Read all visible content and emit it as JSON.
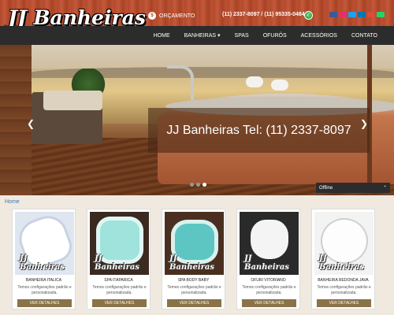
{
  "header": {
    "logo_text": "JJ Banheiras",
    "quote_label": "ORÇAMENTO",
    "phones": "(11) 2337-8097 / (11) 95335-0484",
    "social_colors": [
      "#3b5998",
      "#e1306c",
      "#1da1f2",
      "#0077b5",
      "#dd4b39",
      "#25d366"
    ]
  },
  "nav": {
    "items": [
      "HOME",
      "BANHEIRAS ▾",
      "SPAS",
      "OFURÔS",
      "ACESSÓRIOS",
      "CONTATO"
    ]
  },
  "hero": {
    "caption": "JJ Banheiras Tel: (11) 2337-8097",
    "slide_count": 3,
    "active_slide": 3
  },
  "chat": {
    "status": "Offline",
    "toggle": "⌃"
  },
  "breadcrumb": {
    "home": "Home"
  },
  "products": [
    {
      "title": "BANHEIRA ITALICA",
      "desc": "Temos configurações padrão e personalizada.",
      "button": "VER DETALHES",
      "img_color": "#e8eef6"
    },
    {
      "title": "SPA ITAPARICA",
      "desc": "Temos configurações padrão e personalizada.",
      "button": "VER DETALHES",
      "img_color": "#7fd6d0"
    },
    {
      "title": "SPA BODY BABY",
      "desc": "Temos configurações padrão e personalizada.",
      "button": "VER DETALHES",
      "img_color": "#5dc6c2"
    },
    {
      "title": "OFURI VITORIANO",
      "desc": "Temos configurações padrão e personalizada.",
      "button": "VER DETALHES",
      "img_color": "#f4f4f4"
    },
    {
      "title": "BANHEIRA REDONDA JAVA",
      "desc": "Temos configurações padrão e personalizada.",
      "button": "VER DETALHES",
      "img_color": "#eaeaea"
    }
  ],
  "colors": {
    "header_bg": "#b0492a",
    "nav_bg": "#2c2c2c",
    "button_bg": "#8a7348",
    "link": "#3a78b8"
  }
}
